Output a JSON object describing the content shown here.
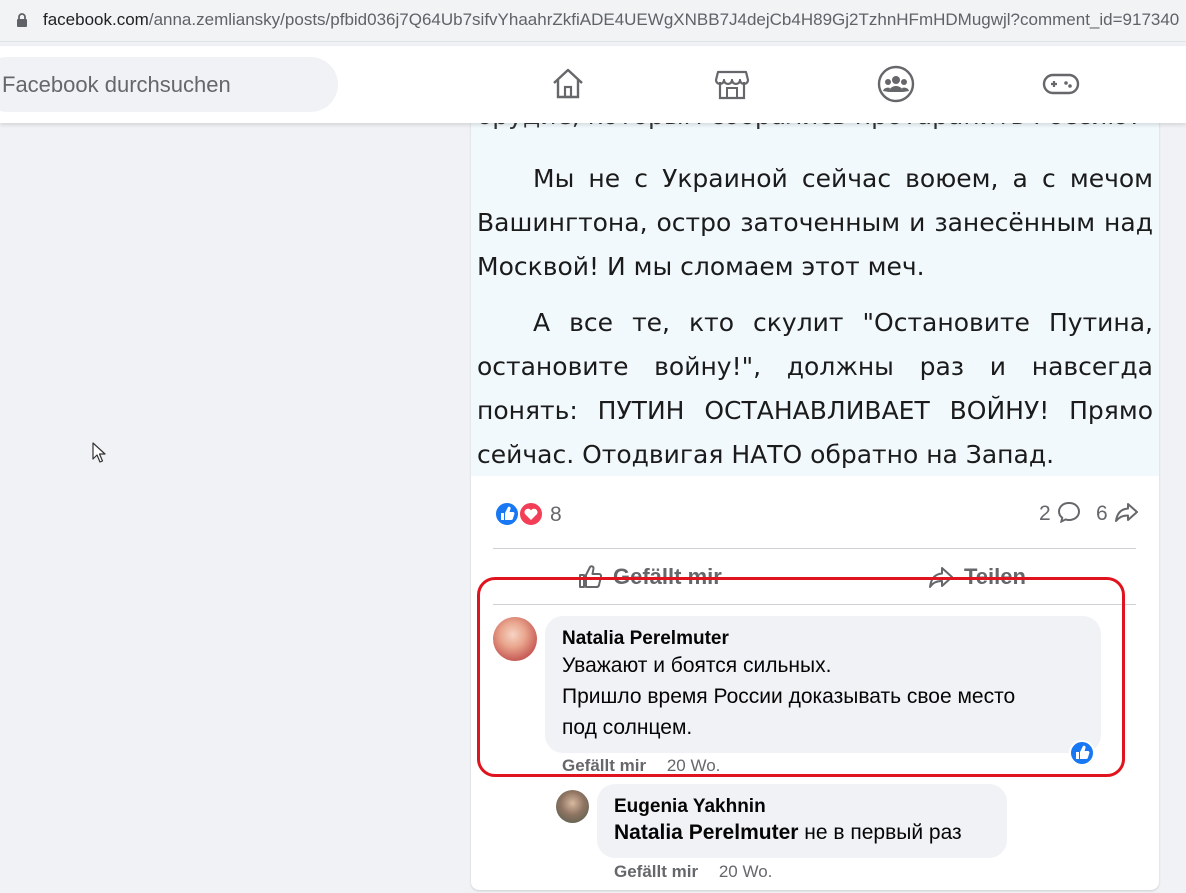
{
  "browser": {
    "url_host": "facebook.com",
    "url_path": "/anna.zemliansky/posts/pfbid036j7Q64Ub7sifvYhaahrZkfiADE4UEWgXNBB7J4dejCb4H89Gj2TzhnHFmHDMugwjl?comment_id=917340"
  },
  "header": {
    "search_placeholder": "Facebook durchsuchen",
    "nav_icons": [
      "home-icon",
      "marketplace-icon",
      "groups-icon",
      "gaming-icon"
    ]
  },
  "post": {
    "image_text": {
      "partial_line": "орудие, которым собрались протаранить Россию?",
      "paragraph1": "Мы не с Украиной сейчас воюем, а с мечом Вашингтона, остро заточенным и занесённым над Москвой! И мы сломаем этот меч.",
      "paragraph2": "А все те, кто скулит \"Остановите Путина, остановите войну!\", должны раз и навсегда понять: ПУТИН ОСТАНАВЛИВАЕТ ВОЙНУ! Прямо сейчас. Отодвигая НАТО обратно на Запад."
    },
    "reaction_count": "8",
    "comment_count": "2",
    "share_count": "6",
    "actions": {
      "like": "Gefällt mir",
      "share": "Teilen"
    }
  },
  "comments": [
    {
      "author": "Natalia Perelmuter",
      "line1": "Уважают и боятся сильных.",
      "line2": "Пришло время России доказывать свое место",
      "line3": "под солнцем.",
      "like_label": "Gefällt mir",
      "age": "20 Wo."
    },
    {
      "author": "Eugenia Yakhnin",
      "mention": "Natalia Perelmuter",
      "text": " не в первый раз",
      "like_label": "Gefällt mir",
      "age": "20 Wo."
    }
  ],
  "colors": {
    "fb_blue": "#1877f2",
    "love_red": "#f33e58",
    "highlight_red": "#e0141e"
  }
}
